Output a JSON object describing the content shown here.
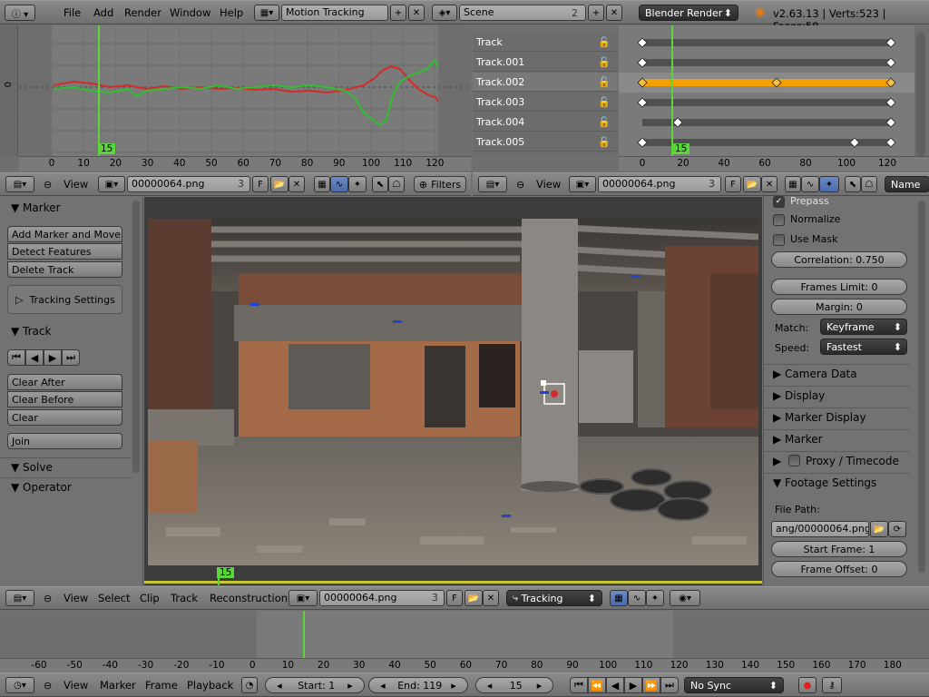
{
  "top_bar": {
    "menus": [
      "File",
      "Add",
      "Render",
      "Window",
      "Help"
    ],
    "screen_layout": "Motion Tracking",
    "scene": "Scene",
    "scene_users": "2",
    "render_engine": "Blender Render",
    "stats": "v2.63.13 | Verts:523 | Faces:58"
  },
  "graph_editor": {
    "x_ticks": [
      "0",
      "10",
      "20",
      "30",
      "40",
      "50",
      "60",
      "70",
      "80",
      "90",
      "100",
      "110",
      "120"
    ],
    "y_label": "0",
    "current_frame": "15",
    "header": {
      "view": "View",
      "clip_name": "00000064.png",
      "users": "3",
      "fake_user": "F",
      "filters": "Filters"
    }
  },
  "dopesheet": {
    "tracks": [
      {
        "name": "Track",
        "selected": false
      },
      {
        "name": "Track.001",
        "selected": false
      },
      {
        "name": "Track.002",
        "selected": true
      },
      {
        "name": "Track.003",
        "selected": false
      },
      {
        "name": "Track.004",
        "selected": false
      },
      {
        "name": "Track.005",
        "selected": false
      }
    ],
    "x_ticks": [
      "0",
      "20",
      "40",
      "60",
      "80",
      "100",
      "120"
    ],
    "current_frame": "15",
    "header": {
      "view": "View",
      "clip_name": "00000064.png",
      "users": "3",
      "fake_user": "F",
      "sort": "Name"
    }
  },
  "tool_shelf": {
    "marker_section": "Marker",
    "add_marker": "Add Marker and Move",
    "detect_features": "Detect Features",
    "delete_track": "Delete Track",
    "tracking_settings": "Tracking Settings",
    "track_section": "Track",
    "clear_after": "Clear After",
    "clear_before": "Clear Before",
    "clear": "Clear",
    "join": "Join",
    "solve_section": "Solve",
    "operator_section": "Operator"
  },
  "properties": {
    "prepass": "Prepass",
    "normalize": "Normalize",
    "use_mask": "Use Mask",
    "correlation": "Correlation: 0.750",
    "frames_limit": "Frames Limit: 0",
    "margin": "Margin: 0",
    "match_label": "Match:",
    "match_value": "Keyframe",
    "speed_label": "Speed:",
    "speed_value": "Fastest",
    "camera_data": "Camera Data",
    "display": "Display",
    "marker_display": "Marker Display",
    "marker": "Marker",
    "proxy_timecode": "Proxy / Timecode",
    "footage_settings": "Footage Settings",
    "file_path_label": "File Path:",
    "file_path": "ang/00000064.png",
    "start_frame": "Start Frame: 1",
    "frame_offset": "Frame Offset: 0"
  },
  "clip_editor": {
    "current_frame": "15",
    "header": {
      "menus": [
        "View",
        "Select",
        "Clip",
        "Track",
        "Reconstruction"
      ],
      "clip_name": "00000064.png",
      "users": "3",
      "fake_user": "F",
      "mode": "Tracking"
    }
  },
  "timeline": {
    "ticks": [
      "-60",
      "-50",
      "-40",
      "-30",
      "-20",
      "-10",
      "0",
      "10",
      "20",
      "30",
      "40",
      "50",
      "60",
      "70",
      "80",
      "90",
      "100",
      "110",
      "120",
      "130",
      "140",
      "150",
      "160",
      "170",
      "180"
    ],
    "menus": [
      "View",
      "Marker",
      "Frame",
      "Playback"
    ],
    "start": "Start: 1",
    "end": "End: 119",
    "frame": "15",
    "sync": "No Sync"
  },
  "colors": {
    "accent": "#f6a000",
    "frame": "#5bd63a",
    "curve_red": "#d42a2a",
    "curve_green": "#2fbf2f"
  }
}
